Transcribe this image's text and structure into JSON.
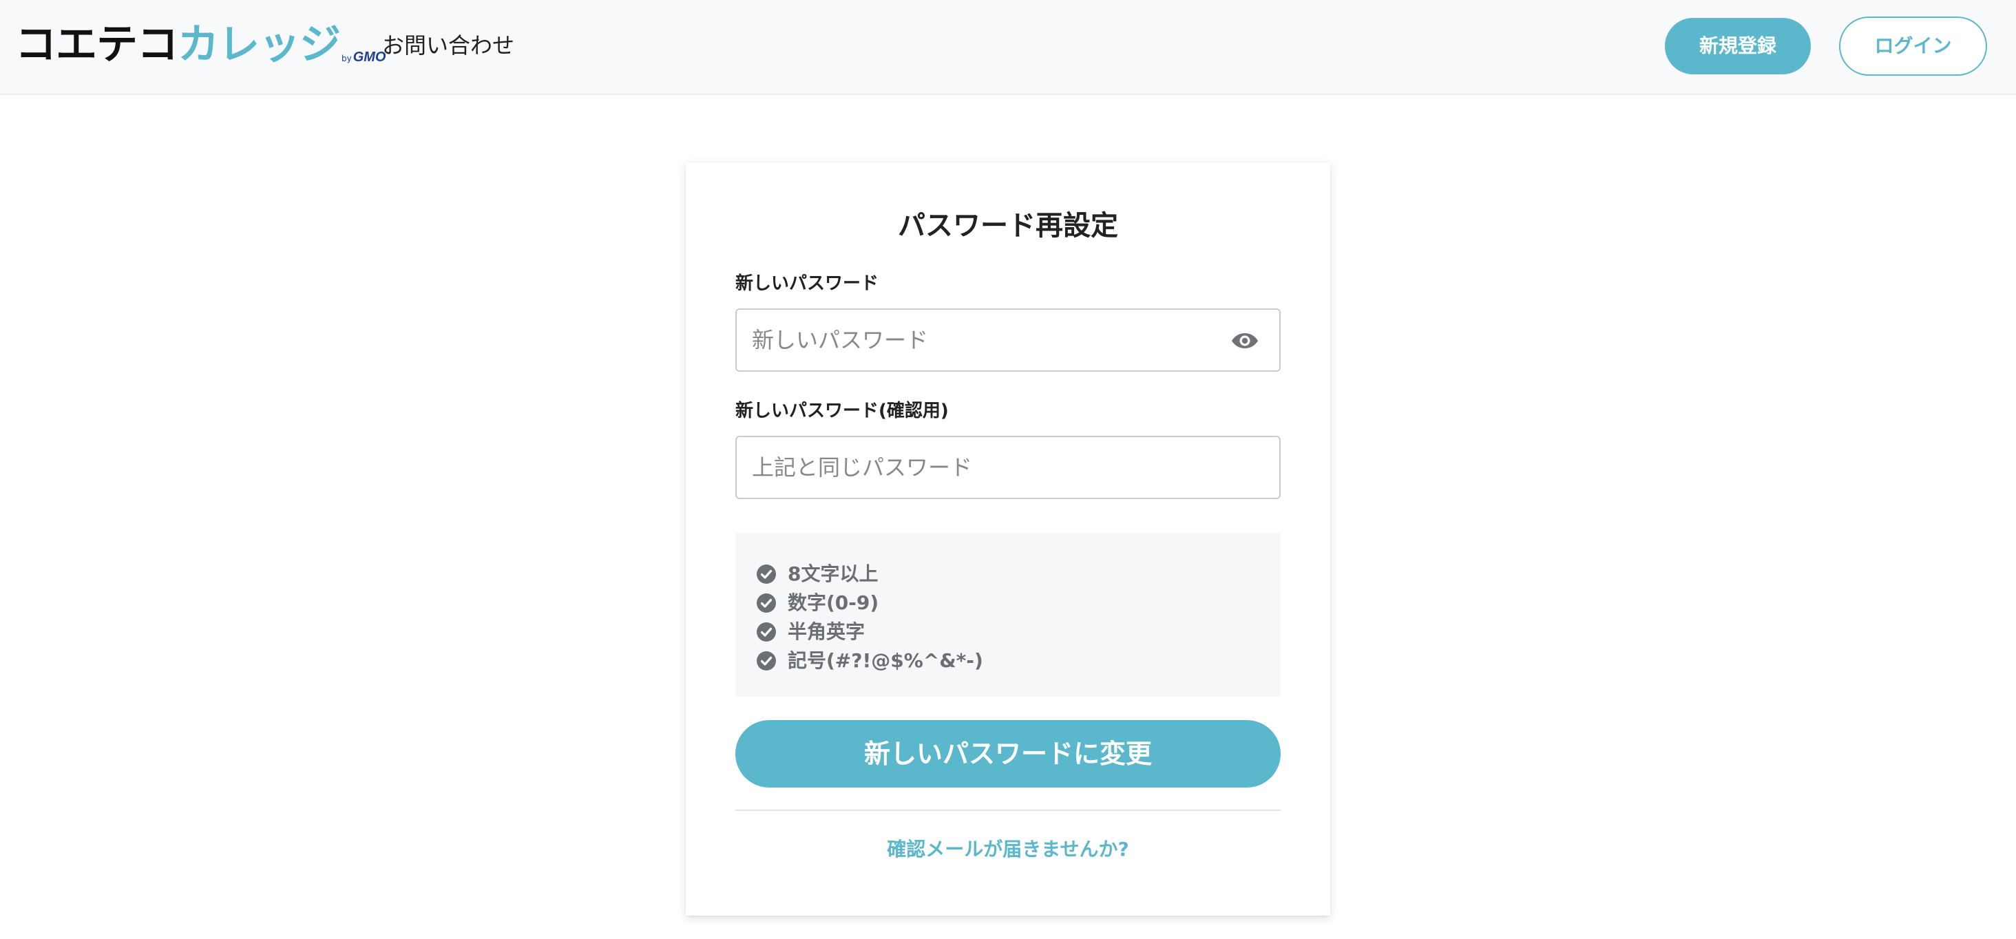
{
  "header": {
    "logo": {
      "main": "コエテコ",
      "accent": "カレッジ",
      "by": "by",
      "company": "GMO"
    },
    "nav_contact": "お問い合わせ",
    "signup_label": "新規登録",
    "login_label": "ログイン"
  },
  "form": {
    "title": "パスワード再設定",
    "new_password": {
      "label": "新しいパスワード",
      "placeholder": "新しいパスワード",
      "value": ""
    },
    "confirm_password": {
      "label": "新しいパスワード(確認用)",
      "placeholder": "上記と同じパスワード",
      "value": ""
    },
    "requirements": [
      "8文字以上",
      "数字(0-9)",
      "半角英字",
      "記号(#?!@$%^&*-)"
    ],
    "submit_label": "新しいパスワードに変更",
    "resend_link": "確認メールが届きませんか?"
  },
  "icons": {
    "visibility_toggle": "eye-icon",
    "requirement_status": "check-circle-icon"
  },
  "colors": {
    "accent": "#5bb8cc",
    "header_bg": "#f8f9fb",
    "requirement_text": "#6b6f74",
    "requirement_box_bg": "#f6f7f8"
  }
}
